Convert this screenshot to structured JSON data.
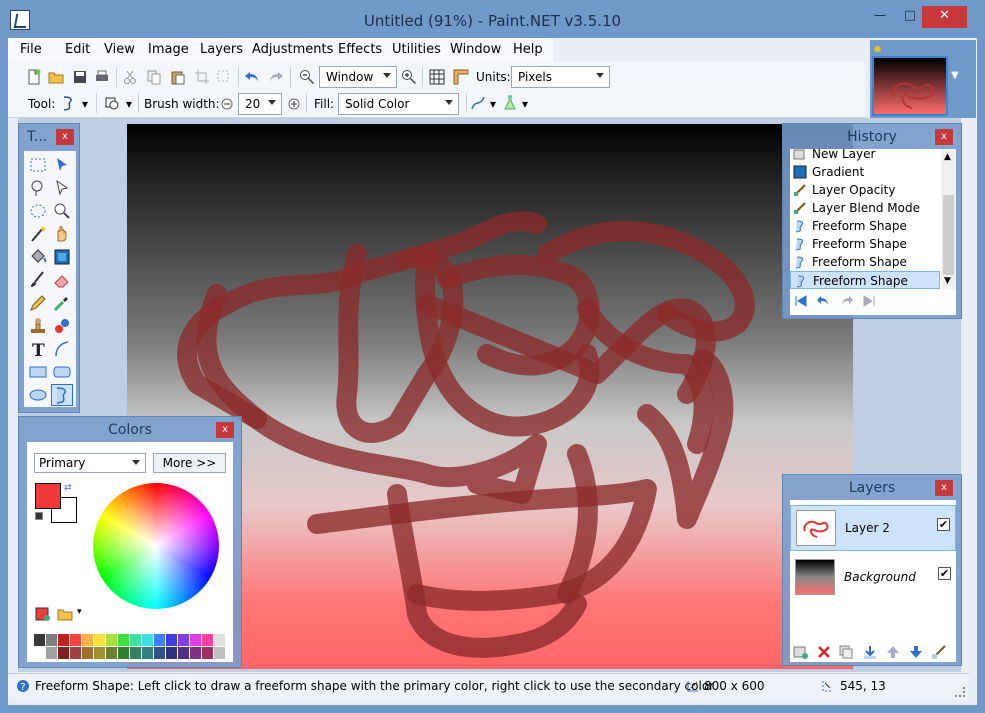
{
  "window": {
    "title": "Untitled (91%) - Paint.NET v3.5.10",
    "min_glyph": "—",
    "max_glyph": "□",
    "close_glyph": "✕"
  },
  "menu": [
    "File",
    "Edit",
    "View",
    "Image",
    "Layers",
    "Adjustments",
    "Effects",
    "Utilities",
    "Window",
    "Help"
  ],
  "toolbar": {
    "zoom_value": "Window",
    "units_label": "Units:",
    "units_value": "Pixels",
    "tool_label": "Tool:",
    "brush_width_label": "Brush width:",
    "brush_width_value": "20",
    "fill_label": "Fill:",
    "fill_value": "Solid Color"
  },
  "tools_panel": {
    "title": "T...",
    "close_glyph": "x"
  },
  "history_panel": {
    "title": "History",
    "close_glyph": "x",
    "items": [
      "New Layer",
      "Gradient",
      "Layer Opacity",
      "Layer Blend Mode",
      "Freeform Shape",
      "Freeform Shape",
      "Freeform Shape",
      "Freeform Shape"
    ],
    "selected_index": 7
  },
  "colors_panel": {
    "title": "Colors",
    "close_glyph": "x",
    "mode_value": "Primary",
    "more_label": "More >>",
    "primary_color": "#f03a3a",
    "secondary_color": "#ffffff"
  },
  "layers_panel": {
    "title": "Layers",
    "close_glyph": "x",
    "layers": [
      {
        "name": "Layer 2",
        "visible": true,
        "selected": true
      },
      {
        "name": "Background",
        "visible": true,
        "selected": false
      }
    ]
  },
  "status": {
    "hint": "Freeform Shape: Left click to draw a freeform shape with the primary color, right click to use the secondary color",
    "image_size": "800 x 600",
    "cursor_pos": "545, 13"
  },
  "colors": {
    "accent": "#3c84d1",
    "close_red": "#c7383a",
    "stroke": "#7a2424"
  }
}
